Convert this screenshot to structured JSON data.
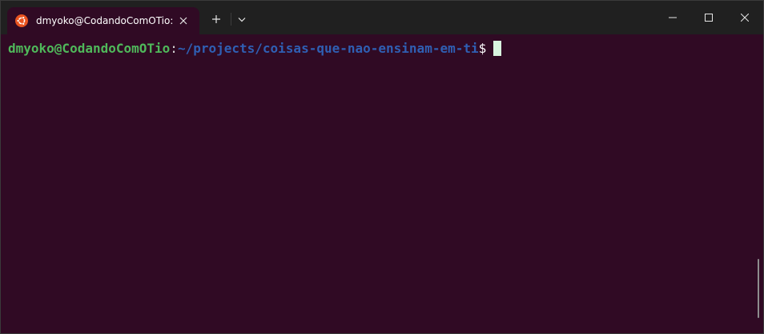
{
  "tab": {
    "title": "dmyoko@CodandoComOTio:",
    "icon": "ubuntu-logo-icon"
  },
  "tabbar": {
    "new_tab_icon": "plus-icon",
    "dropdown_icon": "chevron-down-icon"
  },
  "window_controls": {
    "minimize": "minimize-icon",
    "maximize": "maximize-icon",
    "close": "close-icon"
  },
  "terminal": {
    "user_host": "dmyoko@CodandoComOTio",
    "separator": ":",
    "path": "~/projects/coisas-que-nao-ensinam-em-ti",
    "prompt_symbol": "$"
  },
  "colors": {
    "terminal_bg": "#300a24",
    "titlebar_bg": "#202020",
    "user_host": "#4fb85a",
    "path": "#2f5fb3",
    "cursor": "#d8f5df",
    "ubuntu_orange": "#e95420"
  }
}
